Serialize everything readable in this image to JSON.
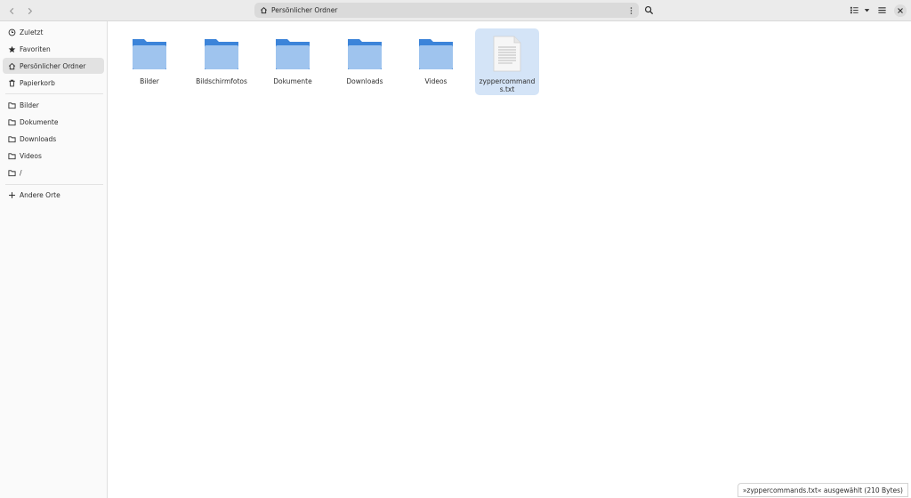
{
  "header": {
    "location": "Persönlicher Ordner"
  },
  "sidebar": {
    "items": [
      {
        "label": "Zuletzt",
        "icon": "clock-icon"
      },
      {
        "label": "Favoriten",
        "icon": "star-icon"
      },
      {
        "label": "Persönlicher Ordner",
        "icon": "home-icon",
        "active": true
      },
      {
        "label": "Papierkorb",
        "icon": "trash-icon"
      }
    ],
    "places": [
      {
        "label": "Bilder",
        "icon": "folder-icon"
      },
      {
        "label": "Dokumente",
        "icon": "folder-icon"
      },
      {
        "label": "Downloads",
        "icon": "folder-icon"
      },
      {
        "label": "Videos",
        "icon": "folder-icon"
      },
      {
        "label": "/",
        "icon": "folder-icon"
      }
    ],
    "other": {
      "label": "Andere Orte",
      "icon": "plus-icon"
    }
  },
  "files": [
    {
      "name": "Bilder",
      "type": "folder"
    },
    {
      "name": "Bildschirmfotos",
      "type": "folder"
    },
    {
      "name": "Dokumente",
      "type": "folder"
    },
    {
      "name": "Downloads",
      "type": "folder"
    },
    {
      "name": "Videos",
      "type": "folder"
    },
    {
      "name": "zyppercommands.txt",
      "type": "text-file",
      "selected": true
    }
  ],
  "status": {
    "text": "»zyppercommands.txt« ausgewählt  (210 Bytes)"
  },
  "colors": {
    "folder_front": "#9fc4ee",
    "folder_back": "#3c84d9",
    "selection": "#d4e4f7"
  }
}
